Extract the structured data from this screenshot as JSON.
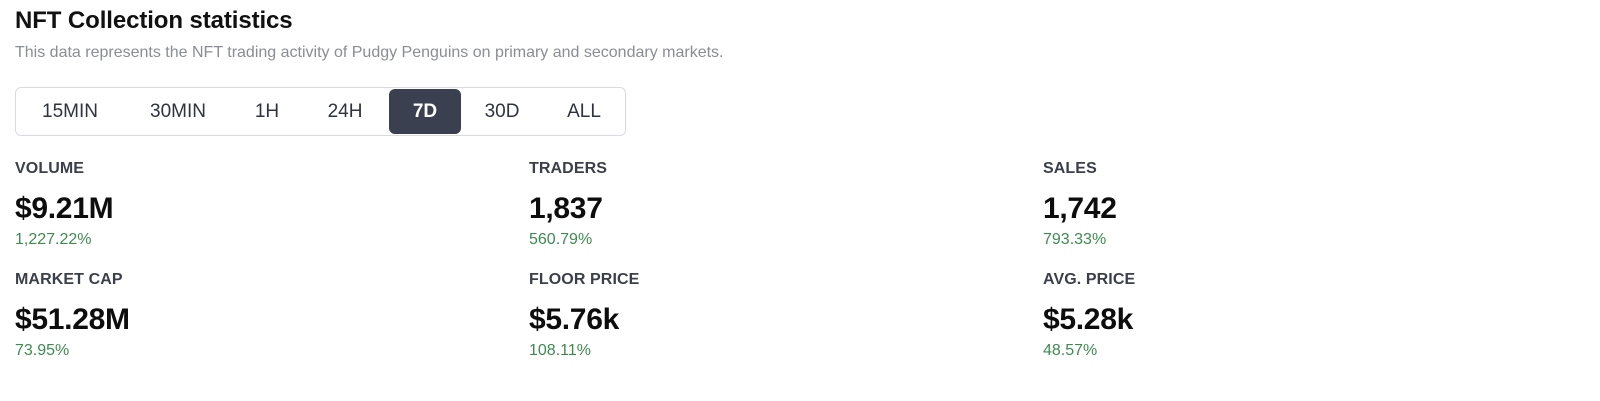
{
  "header": {
    "title": "NFT Collection statistics",
    "subtitle": "This data represents the NFT trading activity of Pudgy Penguins on primary and secondary markets."
  },
  "range_tabs": {
    "selected": "7D",
    "items": [
      {
        "label": "15MIN"
      },
      {
        "label": "30MIN"
      },
      {
        "label": "1H"
      },
      {
        "label": "24H"
      },
      {
        "label": "7D"
      },
      {
        "label": "30D"
      },
      {
        "label": "ALL"
      }
    ]
  },
  "stats": {
    "volume": {
      "label": "VOLUME",
      "value": "$9.21M",
      "change": "1,227.22%"
    },
    "traders": {
      "label": "TRADERS",
      "value": "1,837",
      "change": "560.79%"
    },
    "sales": {
      "label": "SALES",
      "value": "1,742",
      "change": "793.33%"
    },
    "market_cap": {
      "label": "MARKET CAP",
      "value": "$51.28M",
      "change": "73.95%"
    },
    "floor_price": {
      "label": "FLOOR PRICE",
      "value": "$5.76k",
      "change": "108.11%"
    },
    "avg_price": {
      "label": "AVG. PRICE",
      "value": "$5.28k",
      "change": "48.57%"
    }
  },
  "colors": {
    "positive_change": "#3d8b4f",
    "active_tab_bg": "#3a4050",
    "subtitle_text": "#8a8d94"
  }
}
